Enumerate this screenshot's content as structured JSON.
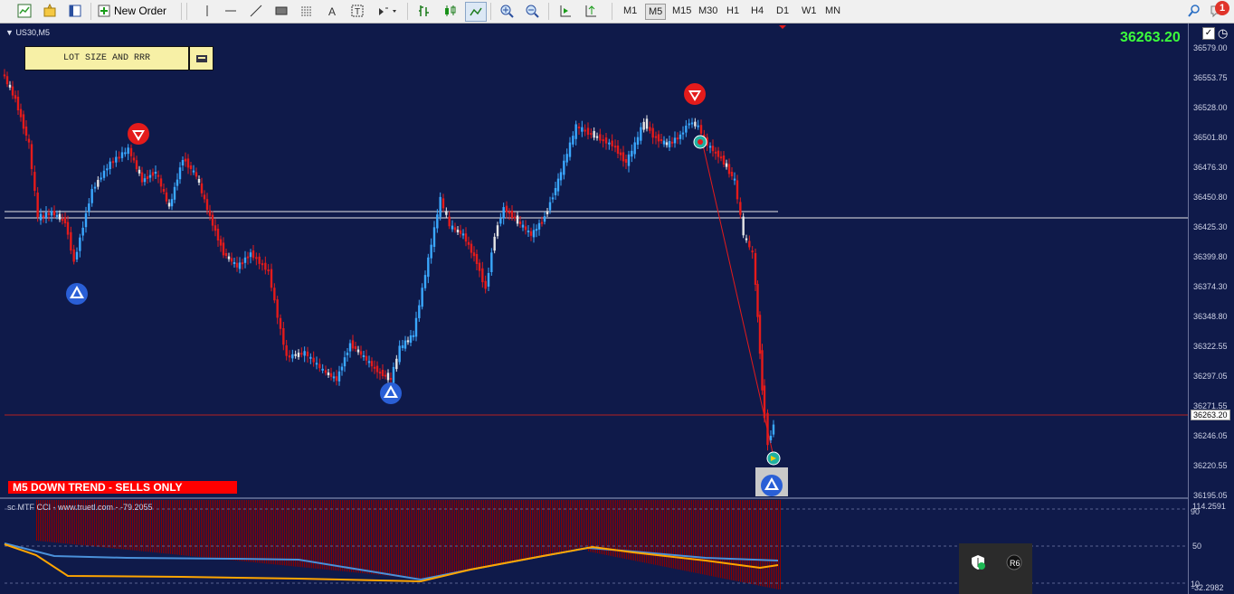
{
  "toolbar": {
    "new_order_label": "New Order",
    "timeframes": [
      "M1",
      "M5",
      "M15",
      "M30",
      "H1",
      "H4",
      "D1",
      "W1",
      "MN"
    ],
    "active_timeframe": "M5",
    "notification_count": "1"
  },
  "chart": {
    "symbol": "US30,M5",
    "current_price": "36263.20",
    "price_tag": "36263.20",
    "lot_panel_label": "LOT SIZE AND RRR",
    "trend_label": "M5  DOWN TREND - SELLS ONLY",
    "price_axis": [
      "36579.00",
      "36553.75",
      "36528.00",
      "36501.80",
      "36476.30",
      "36450.80",
      "36425.30",
      "36399.80",
      "36374.30",
      "36348.80",
      "36322.55",
      "36297.05",
      "36271.55",
      "36246.05",
      "36220.55",
      "36195.05"
    ]
  },
  "indicator": {
    "label": "sc MTF CCI - www.truetl.com - -79.2055",
    "axis_top": "114.2591",
    "axis_90": "90",
    "axis_50": "50",
    "axis_10": "10",
    "axis_bottom": "-32.2982"
  },
  "colors": {
    "background": "#0f1a4a",
    "bull": "#3aa8ff",
    "bear": "#e41b1b",
    "neutral": "#e6e6e6",
    "cci_orange": "#ffa500",
    "cci_blue": "#4a90d9"
  }
}
